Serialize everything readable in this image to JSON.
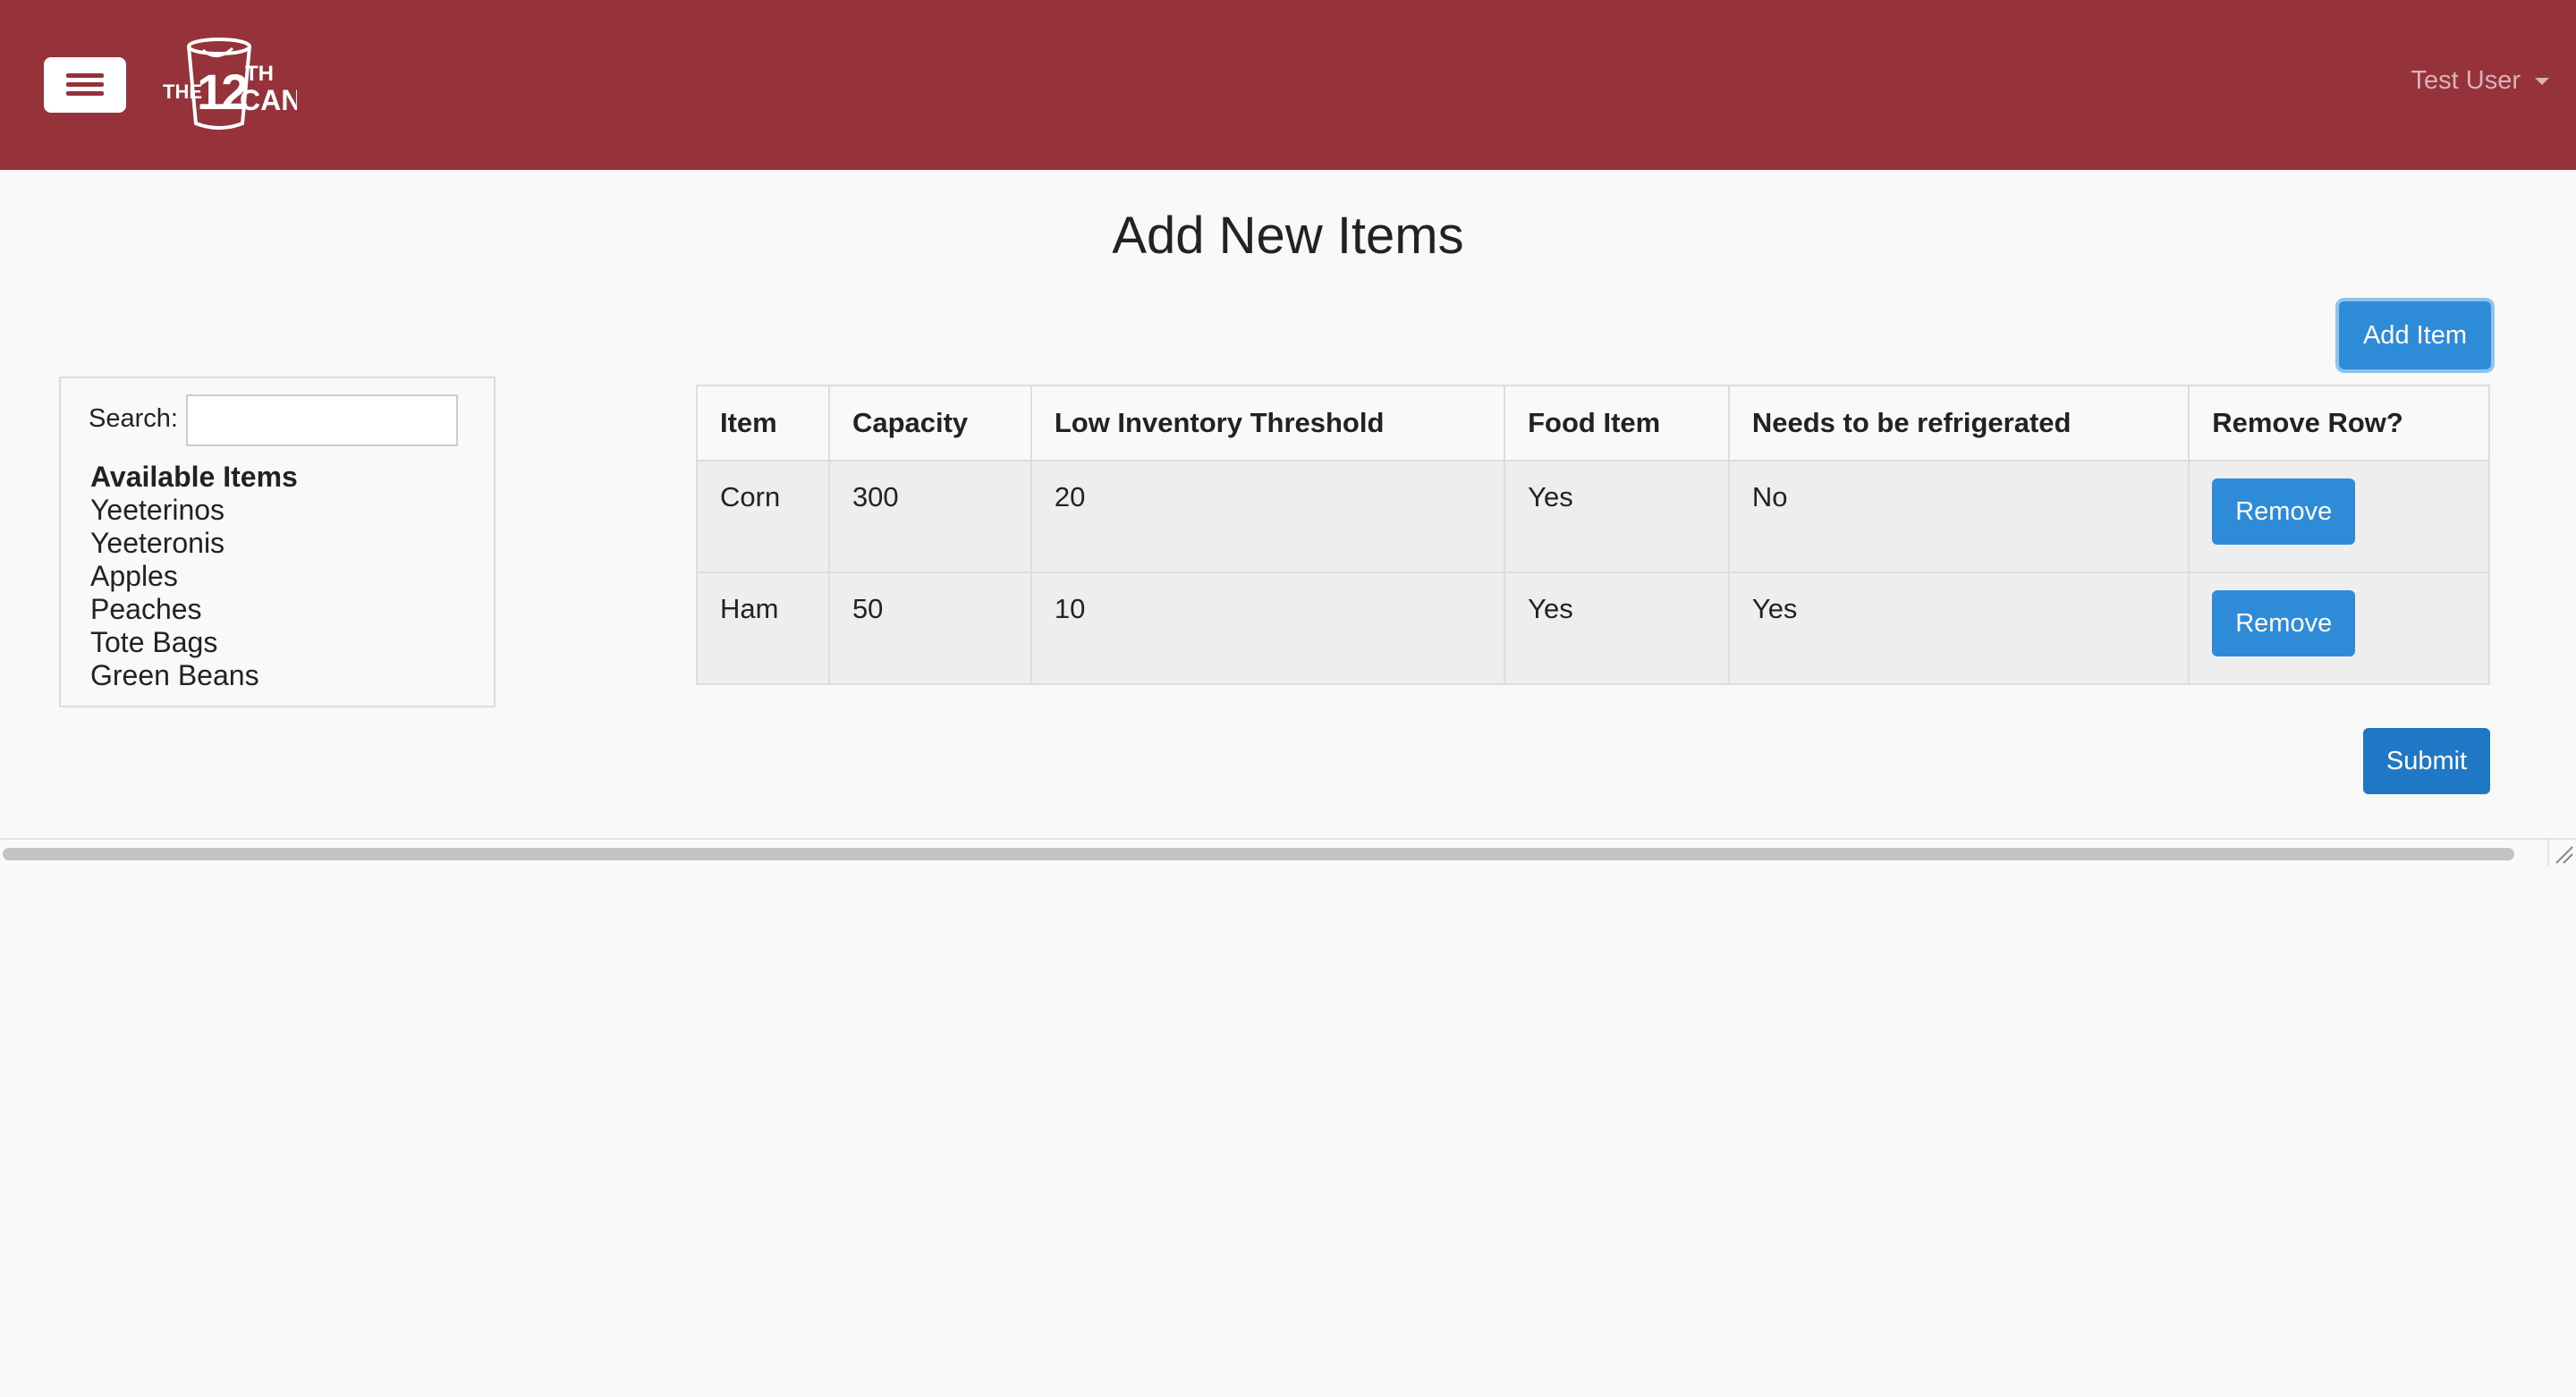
{
  "header": {
    "brand_logo": "the-12th-can-logo",
    "logo_text": "THE 12TH CAN",
    "user_name": "Test User",
    "colors": {
      "navbar": "#96323a",
      "primary_button": "#2e8bd8"
    }
  },
  "page": {
    "title": "Add New Items",
    "add_item_label": "Add Item",
    "submit_label": "Submit"
  },
  "sidebar": {
    "search_label": "Search:",
    "search_value": "",
    "available_heading": "Available Items",
    "available_items": [
      "Yeeterinos",
      "Yeeteronis",
      "Apples",
      "Peaches",
      "Tote Bags",
      "Green Beans"
    ]
  },
  "table": {
    "headers": [
      "Item",
      "Capacity",
      "Low Inventory Threshold",
      "Food Item",
      "Needs to be refrigerated",
      "Remove Row?"
    ],
    "rows": [
      {
        "item": "Corn",
        "capacity": "300",
        "threshold": "20",
        "food_item": "Yes",
        "refrigerated": "No",
        "remove_label": "Remove"
      },
      {
        "item": "Ham",
        "capacity": "50",
        "threshold": "10",
        "food_item": "Yes",
        "refrigerated": "Yes",
        "remove_label": "Remove"
      }
    ]
  }
}
